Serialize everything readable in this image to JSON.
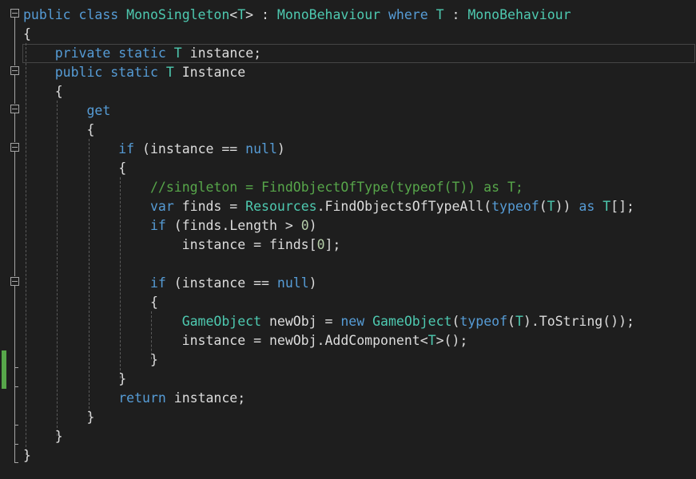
{
  "editor": {
    "accent_colors": {
      "keyword": "#569cd6",
      "type": "#4ec9b0",
      "comment": "#57a64a",
      "number": "#b5cea8",
      "plain": "#dcdcdc",
      "background": "#1e1e1e"
    },
    "lines": [
      {
        "tokens": [
          {
            "t": "kw",
            "v": "public"
          },
          {
            "t": "pl",
            "v": " "
          },
          {
            "t": "kw",
            "v": "class"
          },
          {
            "t": "pl",
            "v": " "
          },
          {
            "t": "tp",
            "v": "MonoSingleton"
          },
          {
            "t": "pl",
            "v": "<"
          },
          {
            "t": "tp",
            "v": "T"
          },
          {
            "t": "pl",
            "v": "> : "
          },
          {
            "t": "tp",
            "v": "MonoBehaviour"
          },
          {
            "t": "pl",
            "v": " "
          },
          {
            "t": "kw",
            "v": "where"
          },
          {
            "t": "pl",
            "v": " "
          },
          {
            "t": "tp",
            "v": "T"
          },
          {
            "t": "pl",
            "v": " : "
          },
          {
            "t": "tp",
            "v": "MonoBehaviour"
          }
        ]
      },
      {
        "tokens": [
          {
            "t": "pl",
            "v": "{"
          }
        ]
      },
      {
        "tokens": [
          {
            "t": "pl",
            "v": "    "
          },
          {
            "t": "kw",
            "v": "private"
          },
          {
            "t": "pl",
            "v": " "
          },
          {
            "t": "kw",
            "v": "static"
          },
          {
            "t": "pl",
            "v": " "
          },
          {
            "t": "tp",
            "v": "T"
          },
          {
            "t": "pl",
            "v": " instance;"
          }
        ]
      },
      {
        "tokens": [
          {
            "t": "pl",
            "v": "    "
          },
          {
            "t": "kw",
            "v": "public"
          },
          {
            "t": "pl",
            "v": " "
          },
          {
            "t": "kw",
            "v": "static"
          },
          {
            "t": "pl",
            "v": " "
          },
          {
            "t": "tp",
            "v": "T"
          },
          {
            "t": "pl",
            "v": " Instance"
          }
        ]
      },
      {
        "tokens": [
          {
            "t": "pl",
            "v": "    {"
          }
        ]
      },
      {
        "tokens": [
          {
            "t": "pl",
            "v": "        "
          },
          {
            "t": "kw",
            "v": "get"
          }
        ]
      },
      {
        "tokens": [
          {
            "t": "pl",
            "v": "        {"
          }
        ]
      },
      {
        "tokens": [
          {
            "t": "pl",
            "v": "            "
          },
          {
            "t": "kw",
            "v": "if"
          },
          {
            "t": "pl",
            "v": " (instance == "
          },
          {
            "t": "kw",
            "v": "null"
          },
          {
            "t": "pl",
            "v": ")"
          }
        ]
      },
      {
        "tokens": [
          {
            "t": "pl",
            "v": "            {"
          }
        ]
      },
      {
        "tokens": [
          {
            "t": "pl",
            "v": "                "
          },
          {
            "t": "cm",
            "v": "//singleton = FindObjectOfType(typeof(T)) as T;"
          }
        ]
      },
      {
        "tokens": [
          {
            "t": "pl",
            "v": "                "
          },
          {
            "t": "kw",
            "v": "var"
          },
          {
            "t": "pl",
            "v": " finds = "
          },
          {
            "t": "tp",
            "v": "Resources"
          },
          {
            "t": "pl",
            "v": ".FindObjectsOfTypeAll("
          },
          {
            "t": "kw",
            "v": "typeof"
          },
          {
            "t": "pl",
            "v": "("
          },
          {
            "t": "tp",
            "v": "T"
          },
          {
            "t": "pl",
            "v": ")) "
          },
          {
            "t": "kw",
            "v": "as"
          },
          {
            "t": "pl",
            "v": " "
          },
          {
            "t": "tp",
            "v": "T"
          },
          {
            "t": "pl",
            "v": "[];"
          }
        ]
      },
      {
        "tokens": [
          {
            "t": "pl",
            "v": "                "
          },
          {
            "t": "kw",
            "v": "if"
          },
          {
            "t": "pl",
            "v": " (finds.Length > "
          },
          {
            "t": "nm",
            "v": "0"
          },
          {
            "t": "pl",
            "v": ")"
          }
        ]
      },
      {
        "tokens": [
          {
            "t": "pl",
            "v": "                    instance = finds["
          },
          {
            "t": "nm",
            "v": "0"
          },
          {
            "t": "pl",
            "v": "];"
          }
        ]
      },
      {
        "tokens": []
      },
      {
        "tokens": [
          {
            "t": "pl",
            "v": "                "
          },
          {
            "t": "kw",
            "v": "if"
          },
          {
            "t": "pl",
            "v": " (instance == "
          },
          {
            "t": "kw",
            "v": "null"
          },
          {
            "t": "pl",
            "v": ")"
          }
        ]
      },
      {
        "tokens": [
          {
            "t": "pl",
            "v": "                {"
          }
        ]
      },
      {
        "tokens": [
          {
            "t": "pl",
            "v": "                    "
          },
          {
            "t": "tp",
            "v": "GameObject"
          },
          {
            "t": "pl",
            "v": " newObj = "
          },
          {
            "t": "kw",
            "v": "new"
          },
          {
            "t": "pl",
            "v": " "
          },
          {
            "t": "tp",
            "v": "GameObject"
          },
          {
            "t": "pl",
            "v": "("
          },
          {
            "t": "kw",
            "v": "typeof"
          },
          {
            "t": "pl",
            "v": "("
          },
          {
            "t": "tp",
            "v": "T"
          },
          {
            "t": "pl",
            "v": ").ToString());"
          }
        ]
      },
      {
        "tokens": [
          {
            "t": "pl",
            "v": "                    instance = newObj.AddComponent<"
          },
          {
            "t": "tp",
            "v": "T"
          },
          {
            "t": "pl",
            "v": ">();"
          }
        ]
      },
      {
        "tokens": [
          {
            "t": "pl",
            "v": "                }"
          }
        ]
      },
      {
        "tokens": [
          {
            "t": "pl",
            "v": "            }"
          }
        ]
      },
      {
        "tokens": [
          {
            "t": "pl",
            "v": "            "
          },
          {
            "t": "kw",
            "v": "return"
          },
          {
            "t": "pl",
            "v": " instance;"
          }
        ]
      },
      {
        "tokens": [
          {
            "t": "pl",
            "v": "        }"
          }
        ]
      },
      {
        "tokens": [
          {
            "t": "pl",
            "v": "    }"
          }
        ]
      },
      {
        "tokens": [
          {
            "t": "pl",
            "v": "}"
          }
        ]
      }
    ]
  }
}
